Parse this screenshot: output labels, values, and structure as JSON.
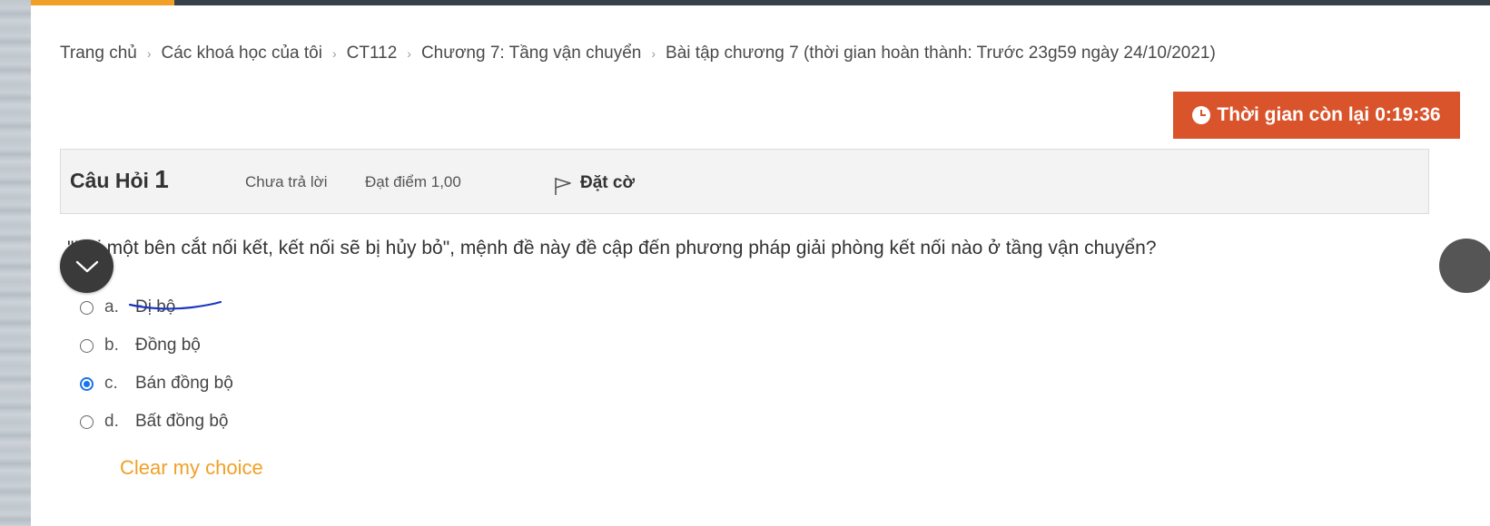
{
  "breadcrumb": {
    "items": [
      "Trang chủ",
      "Các khoá học của tôi",
      "CT112",
      "Chương 7: Tầng vận chuyển",
      "Bài tập chương 7 (thời gian hoàn thành: Trước 23g59 ngày 24/10/2021)"
    ],
    "separator": "›"
  },
  "timer": {
    "label": "Thời gian còn lại",
    "value": "0:19:36",
    "icon": "clock-icon",
    "color": "#d9532b"
  },
  "question": {
    "title_prefix": "Câu Hỏi",
    "number": "1",
    "state": "Chưa trả lời",
    "mark": "Đạt điểm 1,00",
    "flag_label": "Đặt cờ",
    "text": "\"Khi một bên cắt nối kết, kết nối sẽ bị hủy bỏ\", mệnh đề này đề cập đến phương pháp giải phòng kết nối nào ở tầng vận chuyển?",
    "answers": [
      {
        "letter": "a.",
        "text": "Đị bộ",
        "checked": false
      },
      {
        "letter": "b.",
        "text": "Đồng bộ",
        "checked": false
      },
      {
        "letter": "c.",
        "text": "Bán đồng bộ",
        "checked": true
      },
      {
        "letter": "d.",
        "text": "Bất đồng bộ",
        "checked": false
      }
    ],
    "clear_label": "Clear my choice"
  },
  "colors": {
    "accent": "#f0a026",
    "selected": "#1a73e8",
    "topbar": "#37414a"
  }
}
